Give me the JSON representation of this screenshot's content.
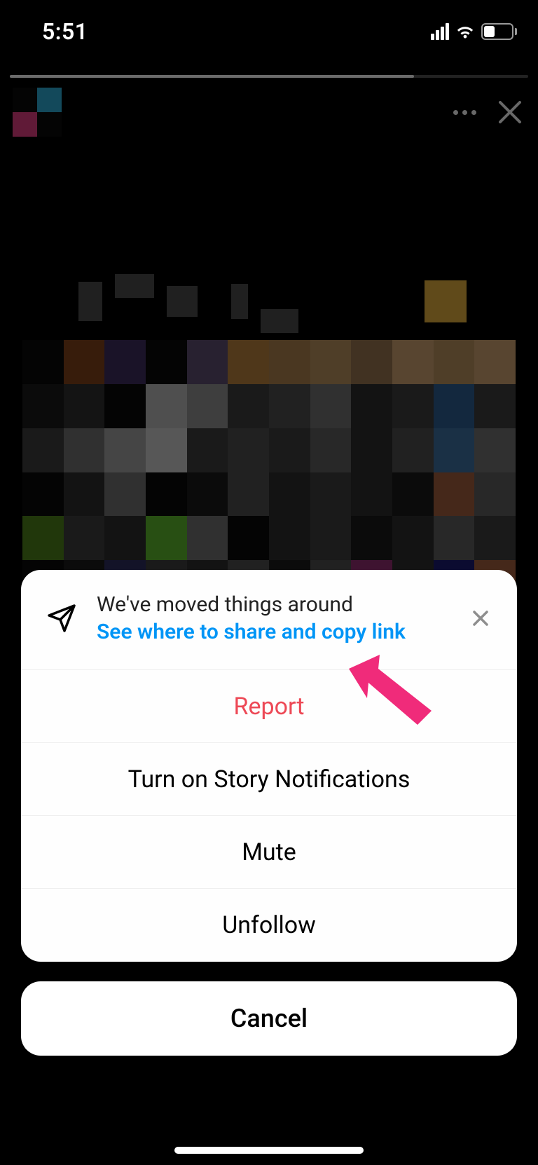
{
  "status": {
    "time": "5:51",
    "battery_pct": "36"
  },
  "colors": {
    "link_blue": "#0095f6",
    "destructive_red": "#ed4956",
    "annotation_pink": "#f02b7a"
  },
  "sheet": {
    "info": {
      "title": "We've moved things around",
      "link": "See where to share and copy link"
    },
    "items": [
      {
        "label": "Report",
        "destructive": true
      },
      {
        "label": "Turn on Story Notifications",
        "destructive": false
      },
      {
        "label": "Mute",
        "destructive": false
      },
      {
        "label": "Unfollow",
        "destructive": false
      }
    ],
    "cancel_label": "Cancel"
  }
}
